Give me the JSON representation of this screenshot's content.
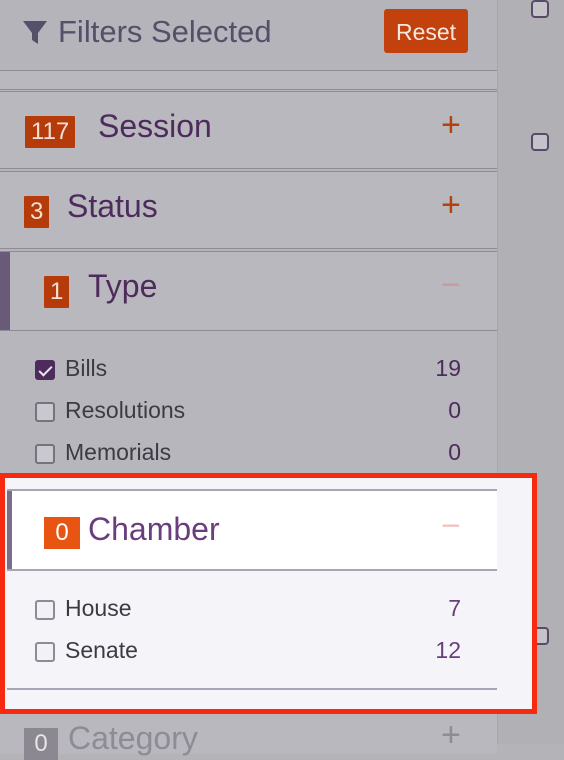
{
  "filters": {
    "title": "Filters Selected",
    "reset_label": "Reset",
    "icon": "funnel-icon"
  },
  "sections": {
    "session": {
      "count": "117",
      "title": "Session",
      "toggle": "+"
    },
    "status": {
      "count": "3",
      "title": "Status",
      "toggle": "+"
    },
    "type": {
      "count": "1",
      "title": "Type",
      "toggle": "−",
      "items": [
        {
          "label": "Bills",
          "count": "19",
          "checked": true
        },
        {
          "label": "Resolutions",
          "count": "0",
          "checked": false
        },
        {
          "label": "Memorials",
          "count": "0",
          "checked": false
        }
      ]
    },
    "chamber": {
      "count": "0",
      "title": "Chamber",
      "toggle": "−",
      "items": [
        {
          "label": "House",
          "count": "7",
          "checked": false
        },
        {
          "label": "Senate",
          "count": "12",
          "checked": false
        }
      ]
    },
    "category": {
      "count": "0",
      "title": "Category",
      "toggle": "+"
    }
  },
  "colors": {
    "accent": "#c2410c",
    "brand": "#4d2c5c",
    "highlight": "#f72a10"
  }
}
